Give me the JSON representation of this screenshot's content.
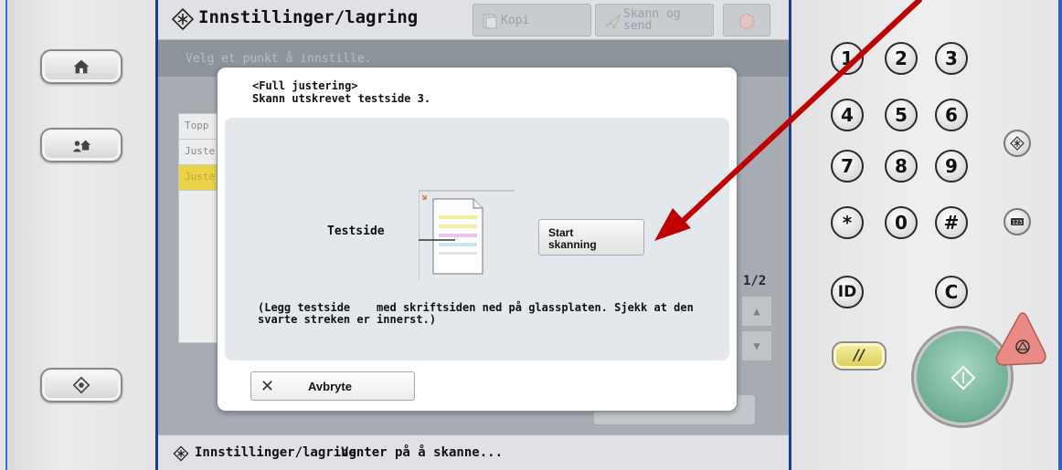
{
  "window": {
    "title": "Innstillinger/lagring",
    "tabs": [
      {
        "label_line1": "Kopi",
        "label_line2": ""
      },
      {
        "label_line1": "Skann og",
        "label_line2": "send"
      }
    ]
  },
  "background": {
    "instruction": "Velg et punkt å innstille.",
    "list_items": [
      "Topp",
      "Juste",
      "Juste"
    ],
    "pager": "1/2",
    "scroll_up": "▲",
    "scroll_down": "▼"
  },
  "dialog": {
    "heading_line1": "<Full justering>",
    "heading_line2": "Skann utskrevet testside 3.",
    "testside_label": "Testside",
    "start_button_line1": "Start",
    "start_button_line2": "skanning",
    "note_line1": "(Legg testside    med skriftsiden ned på glassplaten. Sjekk at den",
    "note_line2": "svarte streken er innerst.)",
    "cancel_label": "Avbryte"
  },
  "status_bar": {
    "title": "Innstillinger/lagring",
    "message": "Venter på å skanne..."
  },
  "keypad": {
    "digits": [
      "1",
      "2",
      "3",
      "4",
      "5",
      "6",
      "7",
      "8",
      "9",
      "*",
      "0",
      "#"
    ],
    "id_key": "ID",
    "clear_key": "C",
    "reset_key": "//",
    "counter_key": "123"
  },
  "colors": {
    "arrow": "#c00000",
    "highlight_row": "#e9d447",
    "start_key": "#6fae94",
    "stop_key": "#e98a86"
  },
  "icons": {
    "home": "home-icon",
    "user_home": "user-home-icon",
    "diamond": "diamond-eye-icon",
    "settings": "settings-asterisk-icon",
    "stop": "stop-icon",
    "start": "start-diamond-icon"
  }
}
